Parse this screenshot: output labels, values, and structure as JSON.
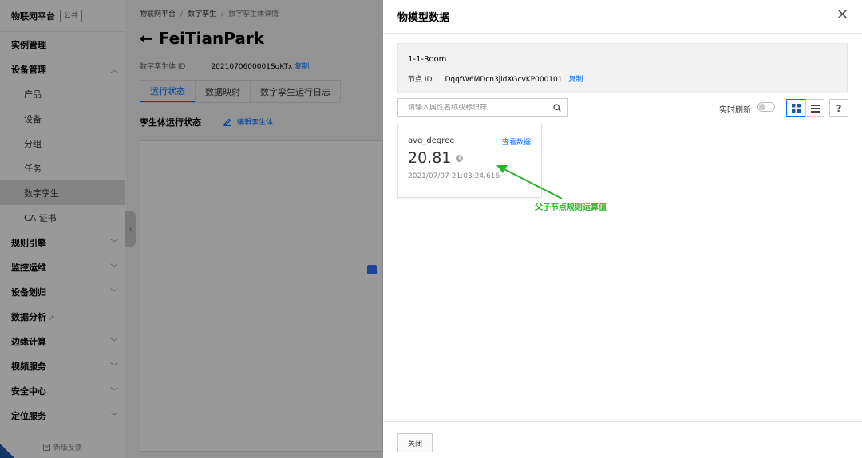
{
  "sidebar": {
    "platform_title": "物联网平台",
    "badge": "公共",
    "items": [
      {
        "label": "实例管理",
        "chevron": ""
      },
      {
        "label": "设备管理",
        "chevron": "︿"
      },
      {
        "label": "产品",
        "chevron": ""
      },
      {
        "label": "设备",
        "chevron": ""
      },
      {
        "label": "分组",
        "chevron": ""
      },
      {
        "label": "任务",
        "chevron": ""
      },
      {
        "label": "数字孪生",
        "chevron": ""
      },
      {
        "label": "CA 证书",
        "chevron": ""
      },
      {
        "label": "规则引擎",
        "chevron": "﹀"
      },
      {
        "label": "监控运维",
        "chevron": "﹀"
      },
      {
        "label": "设备划归",
        "chevron": "﹀"
      },
      {
        "label": "数据分析",
        "chevron": ""
      },
      {
        "label": "边缘计算",
        "chevron": "﹀"
      },
      {
        "label": "视频服务",
        "chevron": "﹀"
      },
      {
        "label": "安全中心",
        "chevron": "﹀"
      },
      {
        "label": "定位服务",
        "chevron": "﹀"
      }
    ],
    "external_icon": "↗",
    "feedback": "新版反馈",
    "collapse_glyph": "‹"
  },
  "main": {
    "breadcrumb": [
      "物联网平台",
      "数字孪生",
      "数字孪生体详情"
    ],
    "breadcrumb_sep": "/",
    "back_arrow": "←",
    "title": "FeiTianPark",
    "twin_id_label": "数字孪生体 ID",
    "twin_id_value": "2021070600001SqKTx",
    "copy_label": "复制",
    "tabs": [
      "运行状态",
      "数据映射",
      "数字孪生运行日志"
    ],
    "section_title": "孪生体运行状态",
    "edit_label": "编辑孪生体"
  },
  "drawer": {
    "title": "物模型数据",
    "close_glyph": "✕",
    "node_name": "1-1-Room",
    "node_id_label": "节点 ID",
    "node_id_value": "DqqfW6MDcn3jidXGcvKP000101",
    "copy_label": "复制",
    "search_placeholder": "请输入属性名称或标识符",
    "realtime_label": "实时刷新",
    "help_glyph": "?",
    "card": {
      "name": "avg_degree",
      "link": "查看数据",
      "value": "20.81",
      "info_glyph": "i",
      "timestamp": "2021/07/07 21:03:24.616"
    },
    "annotation": "父子节点规则运算值",
    "close_button": "关闭"
  },
  "colors": {
    "accent": "#006eff",
    "annotation": "#2bb52b"
  }
}
